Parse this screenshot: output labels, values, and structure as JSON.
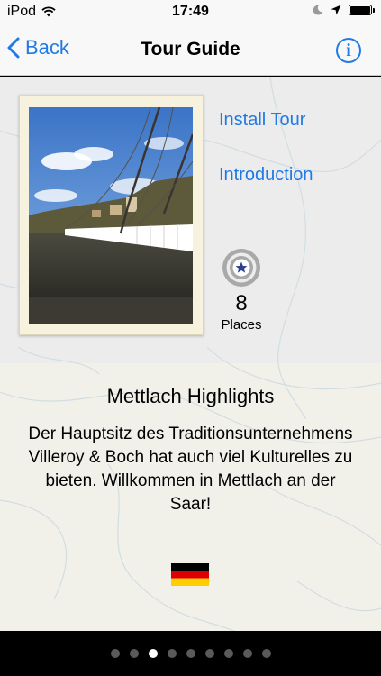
{
  "status_bar": {
    "carrier": "iPod",
    "time": "17:49",
    "wifi_icon": "wifi-icon",
    "moon_icon": "moon-icon",
    "location_icon": "location-arrow-icon",
    "battery_icon": "battery-icon"
  },
  "navbar": {
    "back_label": "Back",
    "title": "Tour Guide",
    "info_label": "i"
  },
  "tour": {
    "install_label": "Install Tour",
    "introduction_label": "Introduction",
    "places_count": "8",
    "places_label": "Places",
    "title": "Mettlach Highlights",
    "description": "Der Hauptsitz des Traditionsunternehmens Villeroy & Boch hat auch viel Kulturelles zu bieten. Willkommen in Mettlach an der Saar!",
    "language_flag": "germany-flag"
  },
  "pager": {
    "pages": 9,
    "current": 3
  },
  "colors": {
    "accent": "#1f7ae6",
    "background": "#f2f1e9",
    "photo_frame": "#f7f2de"
  }
}
